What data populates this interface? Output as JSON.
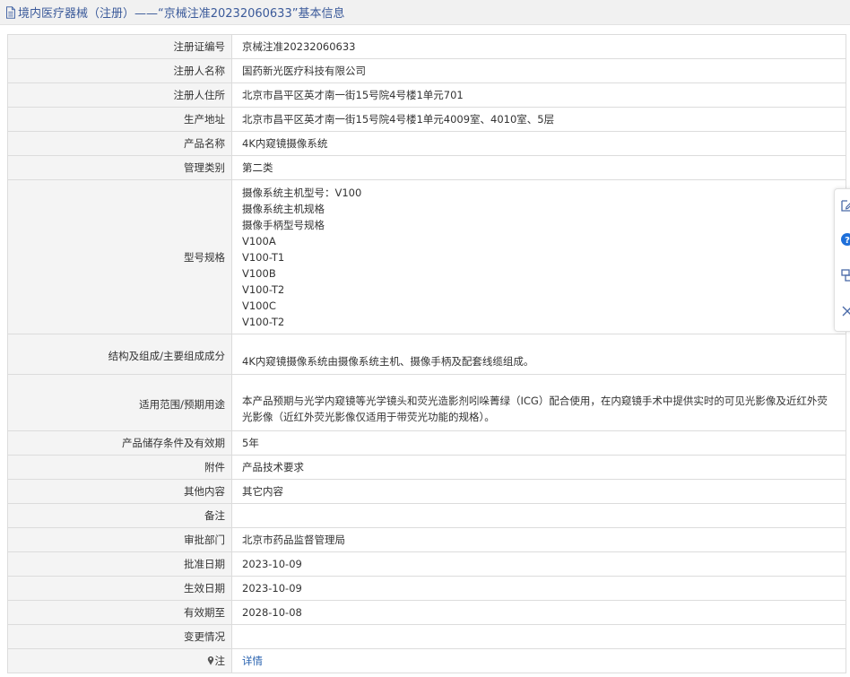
{
  "header": {
    "title": "境内医疗器械（注册）——“京械注准20232060633”基本信息"
  },
  "rows": [
    {
      "label": "注册证编号",
      "value": "京械注准20232060633"
    },
    {
      "label": "注册人名称",
      "value": "国药新光医疗科技有限公司"
    },
    {
      "label": "注册人住所",
      "value": "北京市昌平区英才南一街15号院4号楼1单元701"
    },
    {
      "label": "生产地址",
      "value": "北京市昌平区英才南一街15号院4号楼1单元4009室、4010室、5层"
    },
    {
      "label": "产品名称",
      "value": "4K内窥镜摄像系统"
    },
    {
      "label": "管理类别",
      "value": "第二类"
    },
    {
      "label": "型号规格",
      "lines": [
        "摄像系统主机型号：V100",
        "摄像系统主机规格",
        "摄像手柄型号规格",
        "V100A",
        "V100-T1",
        "V100B",
        "V100-T2",
        "V100C",
        "V100-T2"
      ]
    },
    {
      "label": "结构及组成/主要组成成分",
      "value": "4K内窥镜摄像系统由摄像系统主机、摄像手柄及配套线缆组成。"
    },
    {
      "label": "适用范围/预期用途",
      "value": "本产品预期与光学内窥镜等光学镜头和荧光造影剂吲哚菁绿（ICG）配合使用，在内窥镜手术中提供实时的可见光影像及近红外荧光影像（近红外荧光影像仅适用于带荧光功能的规格）。"
    },
    {
      "label": "产品储存条件及有效期",
      "value": "5年"
    },
    {
      "label": "附件",
      "value": "产品技术要求"
    },
    {
      "label": "其他内容",
      "value": "其它内容"
    },
    {
      "label": "备注",
      "value": ""
    },
    {
      "label": "审批部门",
      "value": "北京市药品监督管理局"
    },
    {
      "label": "批准日期",
      "value": "2023-10-09"
    },
    {
      "label": "生效日期",
      "value": "2023-10-09"
    },
    {
      "label": "有效期至",
      "value": "2028-10-08"
    },
    {
      "label": "变更情况",
      "value": ""
    },
    {
      "label": "注",
      "value": "详情"
    }
  ],
  "icons": {
    "title": "document-icon",
    "note": "pin-icon",
    "toolbar": [
      "edit-icon",
      "help-icon",
      "share-icon",
      "close-icon"
    ]
  },
  "colors": {
    "title_text": "#3b5a9a",
    "label_bg": "#f4f4f4",
    "border": "#dcdcdc",
    "link": "#2a63b0",
    "help_icon": "#1e6fd9"
  }
}
